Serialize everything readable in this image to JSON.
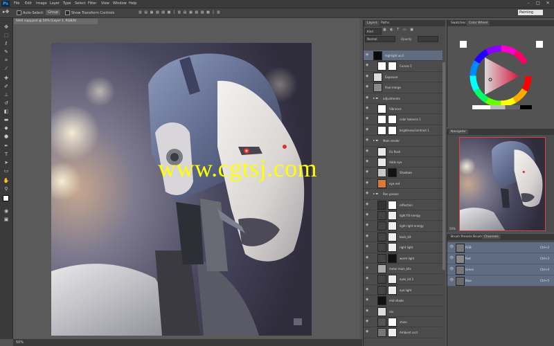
{
  "app": {
    "logo": "Ps"
  },
  "menu": [
    "File",
    "Edit",
    "Image",
    "Layer",
    "Type",
    "Select",
    "Filter",
    "View",
    "Window",
    "Help"
  ],
  "options_bar": {
    "auto_select_label": "Auto-Select:",
    "auto_select_value": "Group",
    "show_transform_label": "Show Transform Controls",
    "workspace": "Painting"
  },
  "document": {
    "tab_title": "Sth0 copy.psd @ 50% (Layer 1, RGB/8)",
    "zoom": "50%",
    "watermark": "www.cgtsj.com"
  },
  "layers_panel": {
    "tabs": [
      "Layers",
      "Paths"
    ],
    "filter": "Kind",
    "blend_mode": "Normal",
    "opacity": "Opacity",
    "fill": "Fill",
    "layers": [
      {
        "name": "highlight acct",
        "selected": true,
        "indent": 0,
        "thumb": "#0a0a0a",
        "mask": ""
      },
      {
        "name": "Curves 1",
        "selected": false,
        "indent": 1,
        "thumb": "#ffffff",
        "mask": "#ffffff"
      },
      {
        "name": "Exposure",
        "selected": false,
        "indent": 0,
        "thumb": "#dcdcdc",
        "mask": ""
      },
      {
        "name": "final merge",
        "selected": false,
        "indent": 0,
        "thumb": "#8a8a8a",
        "mask": ""
      },
      {
        "name": "adjustments",
        "selected": false,
        "indent": 0,
        "group": true,
        "thumb": "",
        "mask": ""
      },
      {
        "name": "Vibrance",
        "selected": false,
        "indent": 1,
        "thumb": "#ffffff",
        "mask": ""
      },
      {
        "name": "color balance 1",
        "selected": false,
        "indent": 1,
        "thumb": "#ffffff",
        "mask": "#ffffff"
      },
      {
        "name": "brightness/contrast 1",
        "selected": false,
        "indent": 1,
        "thumb": "#ffffff",
        "mask": "#ffffff"
      },
      {
        "name": "Main render",
        "selected": false,
        "indent": 0,
        "group": true,
        "thumb": "",
        "mask": ""
      },
      {
        "name": "Fix flash",
        "selected": false,
        "indent": 1,
        "thumb": "#e8e8e8",
        "mask": ""
      },
      {
        "name": "Adds eye",
        "selected": false,
        "indent": 1,
        "thumb": "#e8e8e8",
        "mask": ""
      },
      {
        "name": "Shadows",
        "selected": false,
        "indent": 1,
        "thumb": "#c8c8c8",
        "mask": "#111111"
      },
      {
        "name": "eye red",
        "selected": false,
        "indent": 1,
        "thumb": "#d87a3a",
        "mask": ""
      },
      {
        "name": "Ren passes",
        "selected": false,
        "indent": 0,
        "group": true,
        "thumb": "",
        "mask": ""
      },
      {
        "name": "reflection",
        "selected": false,
        "indent": 1,
        "thumb": "#333333",
        "mask": "#ffffff"
      },
      {
        "name": "light fill energy",
        "selected": false,
        "indent": 1,
        "thumb": "#444444",
        "mask": "#eeeeee"
      },
      {
        "name": "light right energy",
        "selected": false,
        "indent": 1,
        "thumb": "#444444",
        "mask": "#eeeeee"
      },
      {
        "name": "back_kit",
        "selected": false,
        "indent": 1,
        "thumb": "#444444",
        "mask": "#eeeeee"
      },
      {
        "name": "right light",
        "selected": false,
        "indent": 1,
        "thumb": "#444444",
        "mask": "#eeeeee"
      },
      {
        "name": "warm light",
        "selected": false,
        "indent": 1,
        "thumb": "#444444",
        "mask": "#111111"
      },
      {
        "name": "metal main_kits",
        "selected": false,
        "indent": 1,
        "thumb": "#aaaaaa",
        "mask": ""
      },
      {
        "name": "eyes_kit 2",
        "selected": false,
        "indent": 1,
        "thumb": "#444444",
        "mask": "#eeeeee"
      },
      {
        "name": "eye light",
        "selected": false,
        "indent": 1,
        "thumb": "#444444",
        "mask": "#eeeeee"
      },
      {
        "name": "mid shade",
        "selected": false,
        "indent": 1,
        "thumb": "#111111",
        "mask": ""
      },
      {
        "name": "sss",
        "selected": false,
        "indent": 1,
        "thumb": "#dddddd",
        "mask": ""
      },
      {
        "name": "shine",
        "selected": false,
        "indent": 1,
        "thumb": "#555555",
        "mask": "#ffffff"
      },
      {
        "name": "Ambient occl",
        "selected": false,
        "indent": 1,
        "thumb": "#777777",
        "mask": "#eeeeee"
      }
    ]
  },
  "right_panels": {
    "color_tabs": [
      "Swatches",
      "Color Wheel"
    ],
    "navigator_tab": "Navigator",
    "navigator_zoom": "50%",
    "channel_tabs": [
      "Brush Presets",
      "Brush",
      "Channels"
    ],
    "channels": [
      {
        "name": "RGB",
        "key": "Ctrl+2"
      },
      {
        "name": "Red",
        "key": "Ctrl+3"
      },
      {
        "name": "Green",
        "key": "Ctrl+4"
      },
      {
        "name": "Blue",
        "key": "Ctrl+5"
      }
    ]
  },
  "colors": {
    "selection": "#5f6c82",
    "panel": "#4b4b4b",
    "watermark": "#ffff00"
  }
}
